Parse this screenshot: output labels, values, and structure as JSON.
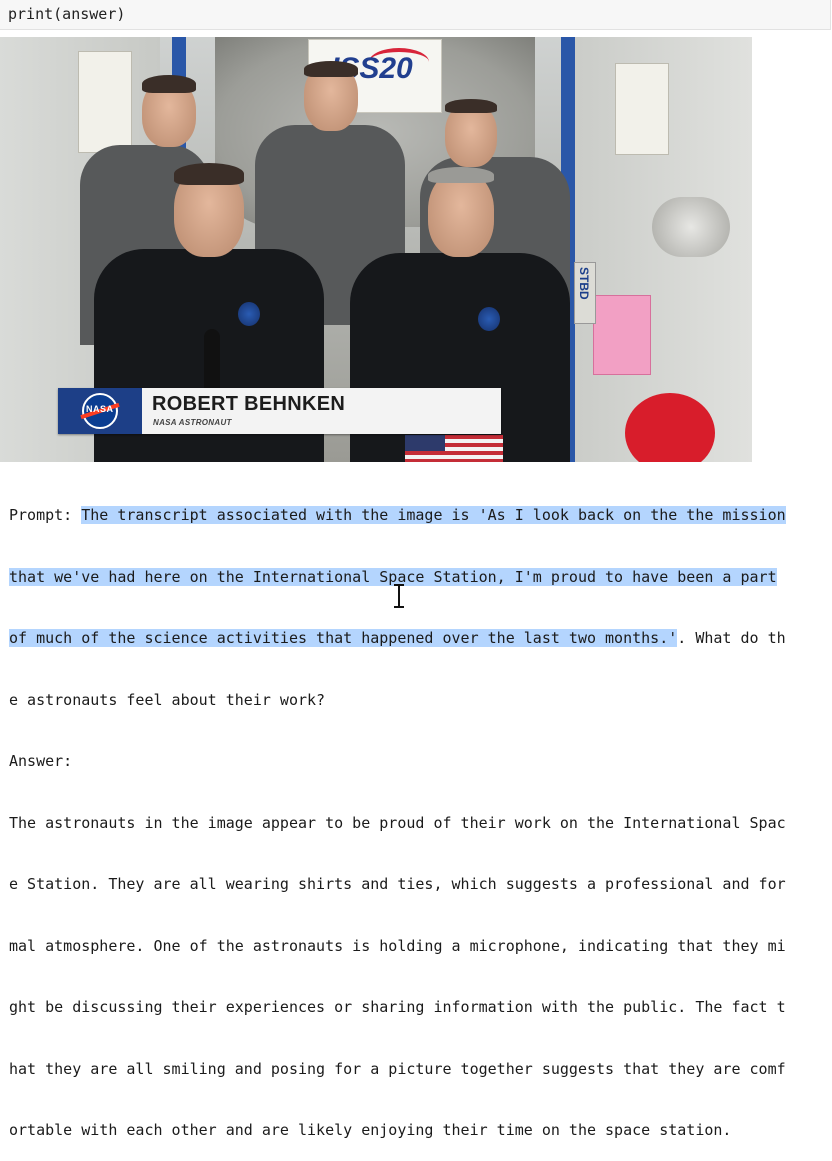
{
  "code_cell": {
    "code": "print(answer)"
  },
  "image": {
    "iss_sign_text": "ISS20",
    "stbd_text": "STBD",
    "lower_third": {
      "logo_text": "NASA",
      "name": "ROBERT BEHNKEN",
      "title": "NASA ASTRONAUT"
    }
  },
  "output": {
    "prompt_label": "Prompt: ",
    "prompt_highlighted_lines": [
      "The transcript associated with the image is 'As I look back on the the mission",
      "that we've had here on the International Space Station, I'm proud to have been a part",
      "of much of the science activities that happened over the last two months.'"
    ],
    "prompt_rest_line3": ". What do th",
    "prompt_line4": "e astronauts feel about their work?",
    "answer_label": "Answer:",
    "answer_lines": [
      "The astronauts in the image appear to be proud of their work on the International Spac",
      "e Station. They are all wearing shirts and ties, which suggests a professional and for",
      "mal atmosphere. One of the astronauts is holding a microphone, indicating that they mi",
      "ght be discussing their experiences or sharing information with the public. The fact t",
      "hat they are all smiling and posing for a picture together suggests that they are comf",
      "ortable with each other and are likely enjoying their time on the space station."
    ]
  }
}
